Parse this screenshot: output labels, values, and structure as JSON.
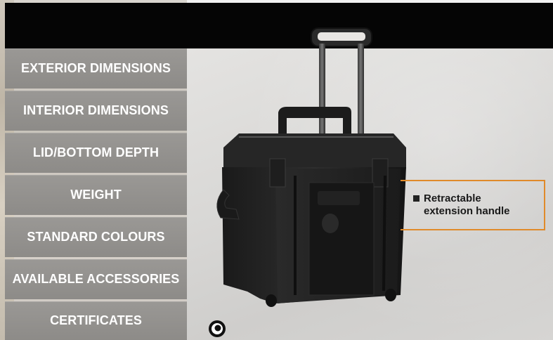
{
  "nav": {
    "items": [
      {
        "label": "EXTERIOR DIMENSIONS"
      },
      {
        "label": "INTERIOR DIMENSIONS"
      },
      {
        "label": "LID/BOTTOM DEPTH"
      },
      {
        "label": "WEIGHT"
      },
      {
        "label": "STANDARD COLOURS"
      },
      {
        "label": "AVAILABLE ACCESSORIES"
      },
      {
        "label": "CERTIFICATES"
      }
    ]
  },
  "callout": {
    "line1": "Retractable",
    "line2": "extension handle"
  },
  "colors": {
    "header": "#050505",
    "nav_button": "#8f8d8a",
    "accent": "#e08a2a"
  },
  "icons": [
    "brand-logo-icon"
  ]
}
